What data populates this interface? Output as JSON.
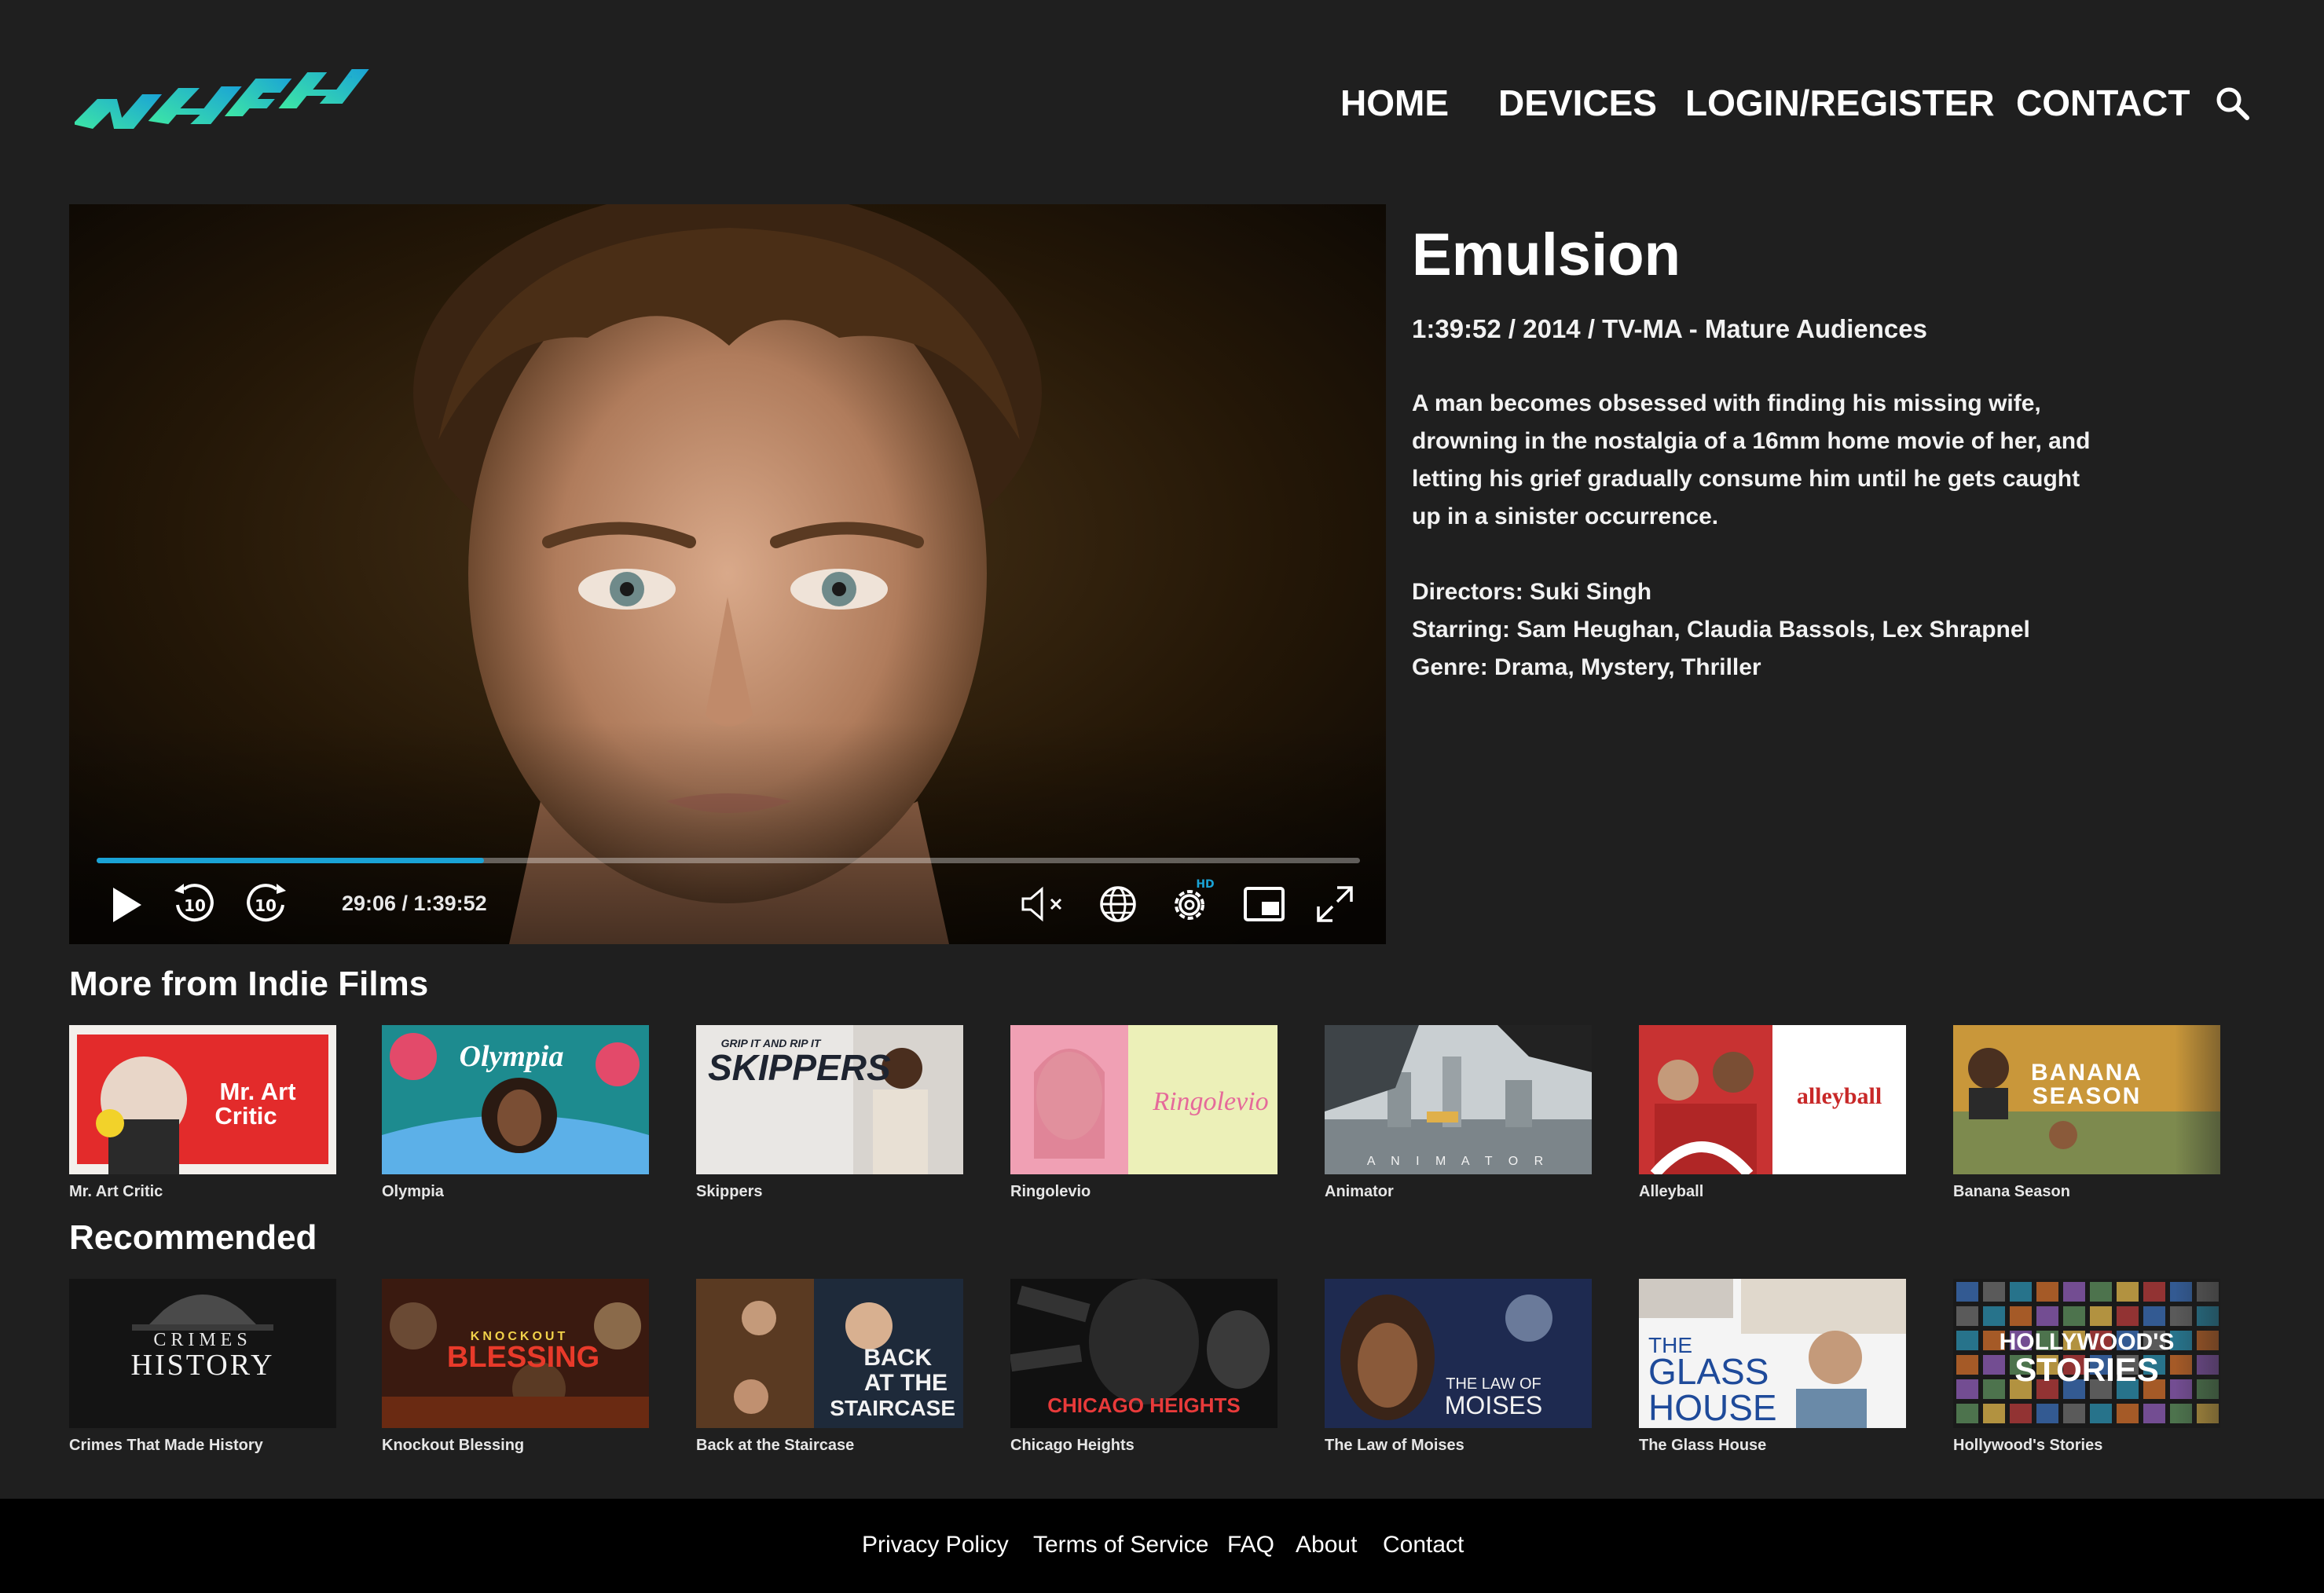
{
  "brand": {
    "accent": "#1aa3d6",
    "logo_gradient": [
      "#3ee8a4",
      "#1aa3d6"
    ]
  },
  "nav": {
    "home": "HOME",
    "devices": "DEVICES",
    "login": "LOGIN/REGISTER",
    "contact": "CONTACT",
    "search_icon": "search-icon"
  },
  "player": {
    "progress_fraction": 0.3067,
    "time_readout": "29:06 / 1:39:52",
    "controls": [
      "play-icon",
      "rewind-10-icon",
      "forward-10-icon",
      "mute-icon",
      "language-icon",
      "settings-icon",
      "pip-icon",
      "fullscreen-icon"
    ],
    "hd_badge": "HD"
  },
  "film": {
    "title": "Emulsion",
    "meta": "1:39:52 / 2014 / TV-MA - Mature Audiences",
    "synopsis": "A man becomes obsessed with finding his missing wife, drown­ing in the nostalgia of a 16mm home movie of her, and letting his grief gradually consume him until he gets caught up in a sinister occurrence.",
    "directors": "Directors: Suki Singh",
    "starring": "Starring: Sam Heughan, Claudia Bassols, Lex Shrapnel",
    "genre": "Genre: Drama, Mystery, Thriller"
  },
  "rows": {
    "more": {
      "title": "More from Indie Films",
      "items": [
        {
          "label": "Mr. Art Critic",
          "art_text": "Mr. Art Critic"
        },
        {
          "label": "Olympia",
          "art_text": "Olympia"
        },
        {
          "label": "Skippers",
          "art_text": "SKIPPERS"
        },
        {
          "label": "Ringolevio",
          "art_text": "Ringolevio"
        },
        {
          "label": "Animator",
          "art_text": "A N I M A T O R"
        },
        {
          "label": "Alleyball",
          "art_text": "alleyball"
        },
        {
          "label": "Banana Season",
          "art_text": "BANANA SEASON"
        }
      ]
    },
    "recommended": {
      "title": "Recommended",
      "items": [
        {
          "label": "Crimes That Made History",
          "art_text": "CRIMES HISTORY"
        },
        {
          "label": "Knockout Blessing",
          "art_text": "BLESSING"
        },
        {
          "label": "Back at the Staircase",
          "art_text": "BACK AT THE STAIRCASE"
        },
        {
          "label": "Chicago Heights",
          "art_text": "CHICAGO HEIGHTS"
        },
        {
          "label": "The Law of Moises",
          "art_text": "THE LAW OF MOISES"
        },
        {
          "label": "The Glass House",
          "art_text": "THE GLASS HOUSE"
        },
        {
          "label": "Hollywood's Stories",
          "art_text": "HOLLYWOOD'S STORIES"
        }
      ]
    }
  },
  "footer": {
    "privacy": "Privacy Policy",
    "terms": "Terms of Service",
    "faq": "FAQ",
    "about": "About",
    "contact": "Contact"
  }
}
